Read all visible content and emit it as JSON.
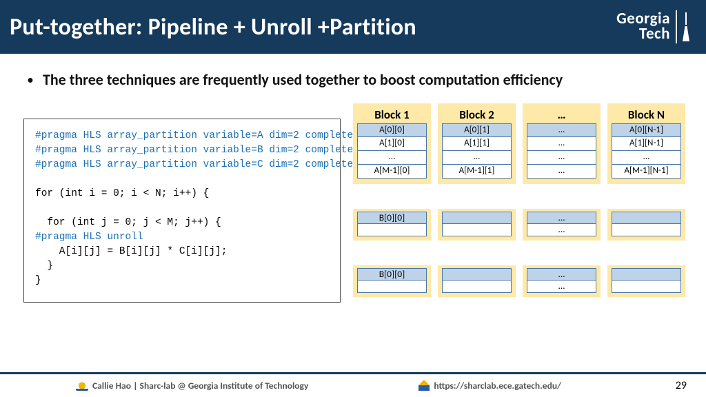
{
  "header": {
    "title": "Put-together: Pipeline + Unroll +Partition",
    "logo_line1": "Georgia",
    "logo_line2": "Tech"
  },
  "bullet": "The three techniques are frequently used together to boost computation efficiency",
  "code": {
    "p1": "#pragma HLS array_partition variable=A dim=2 complete",
    "p2": "#pragma HLS array_partition variable=B dim=2 complete",
    "p3": "#pragma HLS array_partition variable=C dim=2 complete",
    "l1": "for (int i = 0; i < N; i++) {",
    "l2": "  for (int j = 0; j < M; j++) {",
    "p4": "#pragma HLS unroll",
    "l3": "    A[i][j] = B[i][j] * C[i][j];",
    "l4": "  }",
    "l5": "}"
  },
  "blocks": {
    "titles": [
      "Block 1",
      "Block 2",
      "…",
      "Block N"
    ],
    "rowA": {
      "c0": [
        "A[0][0]",
        "A[1][0]",
        "…",
        "A[M-1][0]"
      ],
      "c1": [
        "A[0][1]",
        "A[1][1]",
        "…",
        "A[M-1][1]"
      ],
      "c2": [
        "…",
        "…",
        "…",
        "…"
      ],
      "c3": [
        "A[0][N-1]",
        "A[1][N-1]",
        "…",
        "A[M-1][N-1]"
      ]
    },
    "rowB": {
      "c0": "B[0][0]",
      "c2a": "…",
      "c2b": "…"
    },
    "rowC": {
      "c0": "B[0][0]",
      "c2a": "…",
      "c2b": "…"
    }
  },
  "footer": {
    "author": "Callie Hao | Sharc-lab @ Georgia Institute of Technology",
    "url": "https://sharclab.ece.gatech.edu/",
    "page": "29"
  }
}
